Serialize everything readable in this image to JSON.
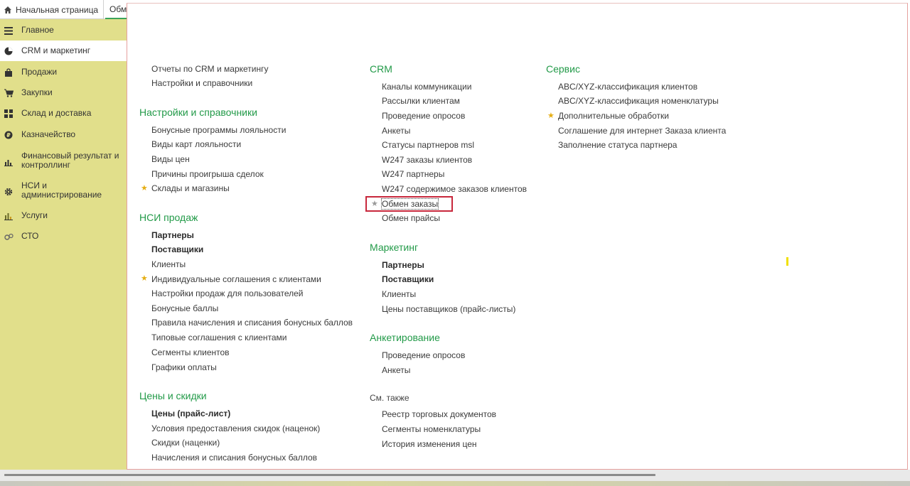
{
  "tabs": {
    "home_label": "Начальная страница",
    "active_label": "Обмен заказы"
  },
  "sidebar": {
    "items": [
      {
        "label": "Главное",
        "icon": "menu-lines-icon"
      },
      {
        "label": "CRM и маркетинг",
        "icon": "pie-chart-icon"
      },
      {
        "label": "Продажи",
        "icon": "bag-icon"
      },
      {
        "label": "Закупки",
        "icon": "cart-icon"
      },
      {
        "label": "Склад и доставка",
        "icon": "grid-icon"
      },
      {
        "label": "Казначейство",
        "icon": "coin-icon"
      },
      {
        "label": "Финансовый результат и контроллинг",
        "icon": "bar-chart-icon"
      },
      {
        "label": "НСИ и администрирование",
        "icon": "gear-icon"
      },
      {
        "label": "Услуги",
        "icon": "bar-chart-icon"
      },
      {
        "label": "СТО",
        "icon": "wrench-icon"
      }
    ]
  },
  "col1": {
    "top_links": [
      "Отчеты по CRM и маркетингу",
      "Настройки и справочники"
    ],
    "settings_title": "Настройки и справочники",
    "settings_links": [
      "Бонусные программы лояльности",
      "Виды карт лояльности",
      "Виды цен",
      "Причины проигрыша сделок",
      "Склады и магазины"
    ],
    "nsi_title": "НСИ продаж",
    "nsi_links": [
      "Партнеры",
      "Поставщики",
      "Клиенты",
      "Индивидуальные соглашения с клиентами",
      "Настройки продаж для пользователей",
      "Бонусные баллы",
      "Правила начисления и списания бонусных баллов",
      "Типовые соглашения с клиентами",
      "Сегменты клиентов",
      "Графики оплаты"
    ],
    "prices_title": "Цены и скидки",
    "prices_links": [
      "Цены (прайс-лист)",
      "Условия предоставления скидок (наценок)",
      "Скидки (наценки)",
      "Начисления и списания бонусных баллов"
    ]
  },
  "col2": {
    "crm_title": "CRM",
    "crm_links": [
      "Каналы коммуникации",
      "Рассылки клиентам",
      "Проведение опросов",
      "Анкеты",
      "Статусы партнеров msl",
      "W247 заказы клиентов",
      "W247 партнеры",
      "W247 содержимое заказов клиентов",
      "Обмен заказы",
      "Обмен прайсы"
    ],
    "marketing_title": "Маркетинг",
    "marketing_links": [
      "Партнеры",
      "Поставщики",
      "Клиенты",
      "Цены поставщиков (прайс-листы)"
    ],
    "survey_title": "Анкетирование",
    "survey_links": [
      "Проведение опросов",
      "Анкеты"
    ],
    "see_also_title": "См. также",
    "see_also_links": [
      "Реестр торговых документов",
      "Сегменты номенклатуры",
      "История изменения цен"
    ]
  },
  "col3": {
    "service_title": "Сервис",
    "service_links": [
      "ABC/XYZ-классификация клиентов",
      "ABC/XYZ-классификация номенклатуры",
      "Дополнительные обработки",
      "Соглашение для интернет Заказа клиента",
      "Заполнение статуса партнера"
    ]
  },
  "colors": {
    "sidebar_bg": "#e1df8b",
    "section_title": "#229a48",
    "highlight_border": "#c8283c",
    "star_gold": "#e5ae14"
  }
}
